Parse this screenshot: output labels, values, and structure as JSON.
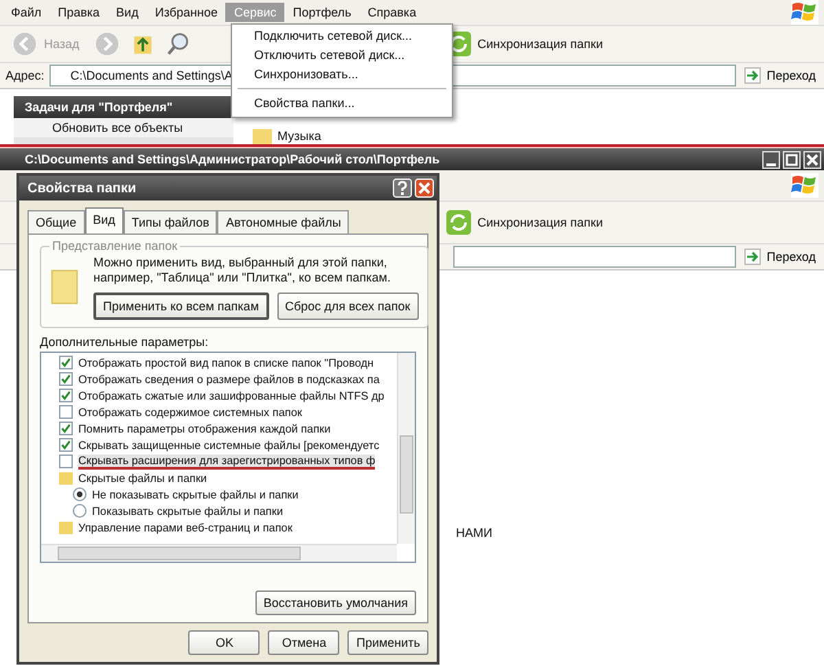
{
  "top_explorer": {
    "menu": [
      {
        "label": "Файл",
        "selected": false
      },
      {
        "label": "Правка",
        "selected": false
      },
      {
        "label": "Вид",
        "selected": false
      },
      {
        "label": "Избранное",
        "selected": false
      },
      {
        "label": "Сервис",
        "selected": true
      },
      {
        "label": "Портфель",
        "selected": false
      },
      {
        "label": "Справка",
        "selected": false
      }
    ],
    "toolbar": {
      "back": "Назад",
      "sync": "Синхронизация папки"
    },
    "address": {
      "label": "Адрес:",
      "value": "C:\\Documents and Settings\\A",
      "go": "Переход"
    },
    "tasks": {
      "title": "Задачи для \"Портфеля\"",
      "items": [
        "Обновить все объекты"
      ]
    },
    "files": [
      "Музыка"
    ],
    "dropdown": [
      {
        "kind": "item",
        "label": "Подключить сетевой диск..."
      },
      {
        "kind": "item",
        "label": "Отключить сетевой диск..."
      },
      {
        "kind": "item",
        "label": "Синхронизовать..."
      },
      {
        "kind": "separator"
      },
      {
        "kind": "item",
        "label": "Свойства папки..."
      }
    ]
  },
  "bottom_explorer": {
    "title": "C:\\Documents and Settings\\Администратор\\Рабочий стол\\Портфель",
    "sync": "Синхронизация папки",
    "go": "Переход",
    "content_text": "НАМИ"
  },
  "dialog": {
    "title": "Свойства папки",
    "tabs": [
      {
        "label": "Общие",
        "selected": false
      },
      {
        "label": "Вид",
        "selected": true
      },
      {
        "label": "Типы файлов",
        "selected": false
      },
      {
        "label": "Автономные файлы",
        "selected": false
      }
    ],
    "group": {
      "title": "Представление папок",
      "text": "Можно применить вид, выбранный для этой папки, например, \"Таблица\" или \"Плитка\", ко всем папкам.",
      "buttons": [
        "Применить ко всем папкам",
        "Сброс для всех папок"
      ]
    },
    "advanced_label": "Дополнительные параметры:",
    "options": [
      {
        "kind": "checkbox",
        "label": "Отображать простой вид папок в списке папок \"Проводн",
        "checked": true,
        "selected": false
      },
      {
        "kind": "checkbox",
        "label": "Отображать сведения о размере файлов в подсказках па",
        "checked": true,
        "selected": false
      },
      {
        "kind": "checkbox",
        "label": "Отображать сжатые или зашифрованные файлы NTFS др",
        "checked": true,
        "selected": false
      },
      {
        "kind": "checkbox",
        "label": "Отображать содержимое системных папок",
        "checked": false,
        "selected": false
      },
      {
        "kind": "checkbox",
        "label": "Помнить параметры отображения каждой папки",
        "checked": true,
        "selected": false
      },
      {
        "kind": "checkbox",
        "label": "Скрывать защищенные системные файлы [рекомендуетс",
        "checked": true,
        "selected": false
      },
      {
        "kind": "checkbox",
        "label": "Скрывать расширения для зарегистрированных типов ф",
        "checked": false,
        "selected": true
      },
      {
        "kind": "folder",
        "label": "Скрытые файлы и папки",
        "children": [
          {
            "kind": "radio",
            "label": "Не показывать скрытые файлы и папки",
            "checked": true
          },
          {
            "kind": "radio",
            "label": "Показывать скрытые файлы и папки",
            "checked": false
          }
        ]
      },
      {
        "kind": "folder",
        "label": "Управление парами веб-страниц и папок"
      }
    ],
    "restore": "Восстановить умолчания",
    "buttons": [
      "OK",
      "Отмена",
      "Применить"
    ]
  }
}
